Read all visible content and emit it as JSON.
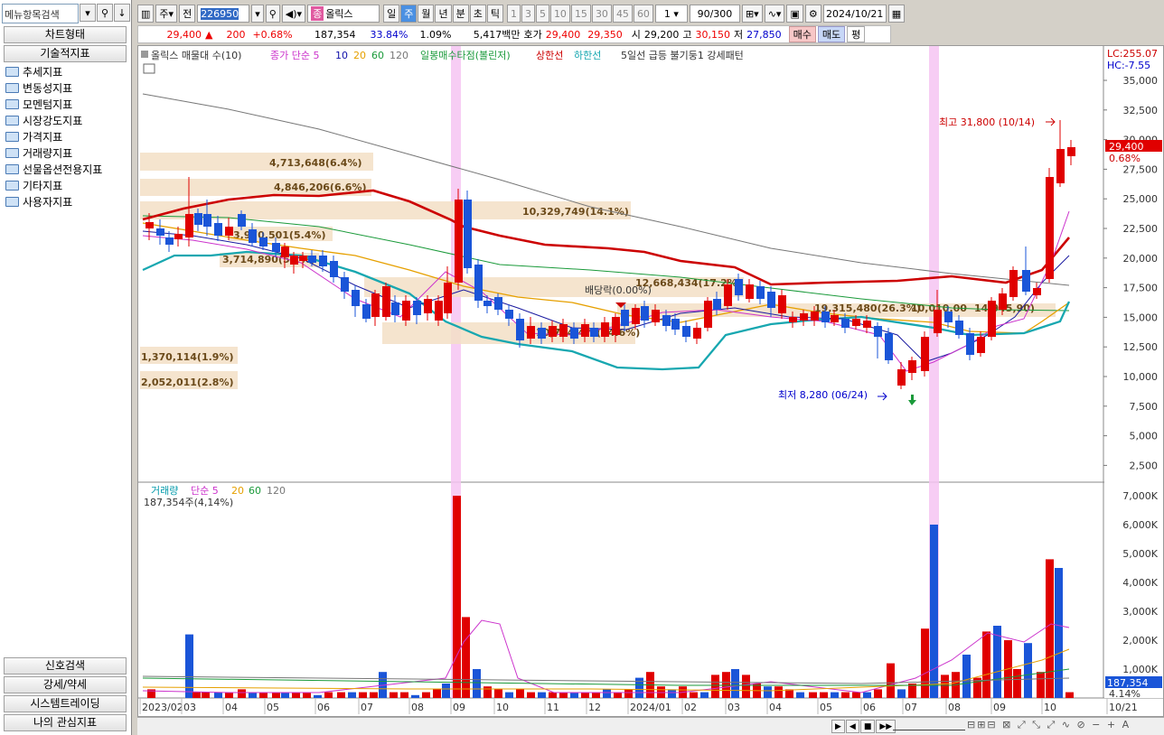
{
  "left_panel": {
    "search_placeholder": "메뉴항목검색",
    "header_chart_type": "차트형태",
    "header_technical": "기술적지표",
    "folders": [
      "추세지표",
      "변동성지표",
      "모멘텀지표",
      "시장강도지표",
      "가격지표",
      "거래량지표",
      "선물옵션전용지표",
      "기타지표",
      "사용자지표"
    ],
    "bottom_buttons": [
      "신호검색",
      "강세/약세",
      "시스템트레이딩",
      "나의 관심지표"
    ]
  },
  "toolbar": {
    "period": "주",
    "prev": "전",
    "code": "226950",
    "name": "올릭스",
    "name_badge": "종",
    "periods": [
      "일",
      "주",
      "월",
      "년",
      "분",
      "초",
      "틱"
    ],
    "selected_period": "주",
    "nums": [
      "1",
      "3",
      "5",
      "10",
      "15",
      "30",
      "45",
      "60"
    ],
    "count_sel": "1",
    "count": "90",
    "count_max": "/300",
    "date": "2024/10/21"
  },
  "quote": {
    "price": "29,400",
    "arrow": "▲",
    "change": "200",
    "pct": "+0.68%",
    "volume": "187,354",
    "turnover": "33.84%",
    "ratio": "1.09%",
    "amount": "5,417백만",
    "ask_label": "호가",
    "ask": "29,400",
    "bid": "29,350",
    "open_label": "시",
    "open": "29,200",
    "high_label": "고",
    "high": "30,150",
    "low_label": "저",
    "low": "27,850",
    "buy": "매수",
    "sell": "매도",
    "eval": "평"
  },
  "price_legend": {
    "title": "올릭스 매물대 수(10)",
    "ma_label": "종가 단순 5",
    "ma10": "10",
    "ma20": "20",
    "ma60": "60",
    "ma120": "120",
    "bb": "일봉매수타점(볼린저)",
    "upper": "상한선",
    "lower": "하한선",
    "pattern": "5일선 급등 불기둥1 강세패턴"
  },
  "lc": "LC:255.07",
  "hc": "HC:-7.55",
  "current_tag": "29,400",
  "current_pct": "0.68%",
  "high_note": "최고 31,800 (10/14)",
  "low_note": "최저 8,280 (06/24)",
  "dividend_note": "배당락(0.00%)",
  "vol_legend": {
    "title": "거래량",
    "ma5": "단순 5",
    "ma20": "20",
    "ma60": "60",
    "ma120": "120"
  },
  "vol_value": "187,354주(4,14%)",
  "vol_tag": "187,354",
  "vol_tag_pct": "4.14%",
  "volume_profile": [
    {
      "label": "4,713,648(6.4%)"
    },
    {
      "label": "4,846,206(6.6%)"
    },
    {
      "label": "10,329,749(14.1%)"
    },
    {
      "label": "3,970,501(5.4%)"
    },
    {
      "label": "3,714,890(5.1%)"
    },
    {
      "label": "12,668,434(17.2%)"
    },
    {
      "label": "19,315,480(26.3%)"
    },
    {
      "label": "10,010,00"
    },
    {
      "label": "14,945,90)"
    },
    {
      "label": "10,724,4??(14.6%)"
    },
    {
      "label": "1,370,114(1.9%)"
    },
    {
      "label": "2,052,011(2.8%)"
    }
  ],
  "chart_data": {
    "type": "candlestick",
    "price_axis": [
      "35,000",
      "32,500",
      "30,000",
      "27,500",
      "25,000",
      "22,500",
      "20,000",
      "17,500",
      "15,000",
      "12,500",
      "10,000",
      "7,500",
      "5,000",
      "2,500"
    ],
    "volume_axis": [
      "7,000K",
      "6,000K",
      "5,000K",
      "4,000K",
      "3,000K",
      "2,000K",
      "1,000K"
    ],
    "x_labels": [
      "2023/02",
      "03",
      "04",
      "05",
      "06",
      "07",
      "08",
      "09",
      "10",
      "11",
      "12",
      "2024/01",
      "02",
      "03",
      "04",
      "05",
      "06",
      "07",
      "08",
      "09",
      "10",
      "10/21"
    ]
  }
}
